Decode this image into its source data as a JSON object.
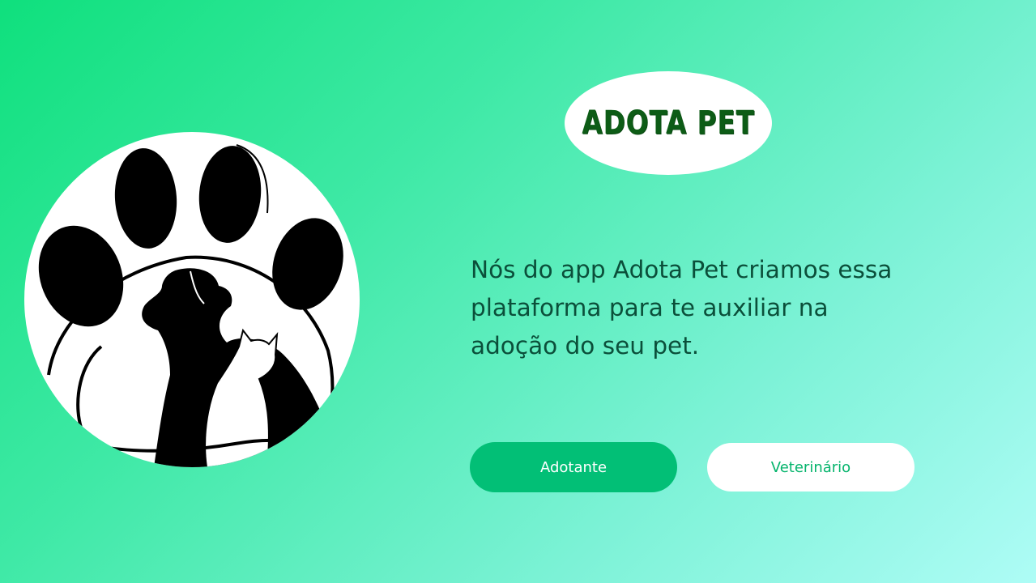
{
  "brand": {
    "title": "ADOTA PET",
    "title_color": "#0d5c16"
  },
  "hero": {
    "logo_icon": "paw-with-dog-and-cat-icon",
    "description": "Nós do app Adota Pet criamos essa plataforma para te auxiliar na adoção do seu pet."
  },
  "actions": {
    "adopter_label": "Adotante",
    "vet_label": "Veterinário"
  },
  "colors": {
    "background_start": "#0fe07d",
    "background_end": "#aefcf6",
    "primary_button": "#02bf76",
    "secondary_button_text": "#05b46c"
  }
}
